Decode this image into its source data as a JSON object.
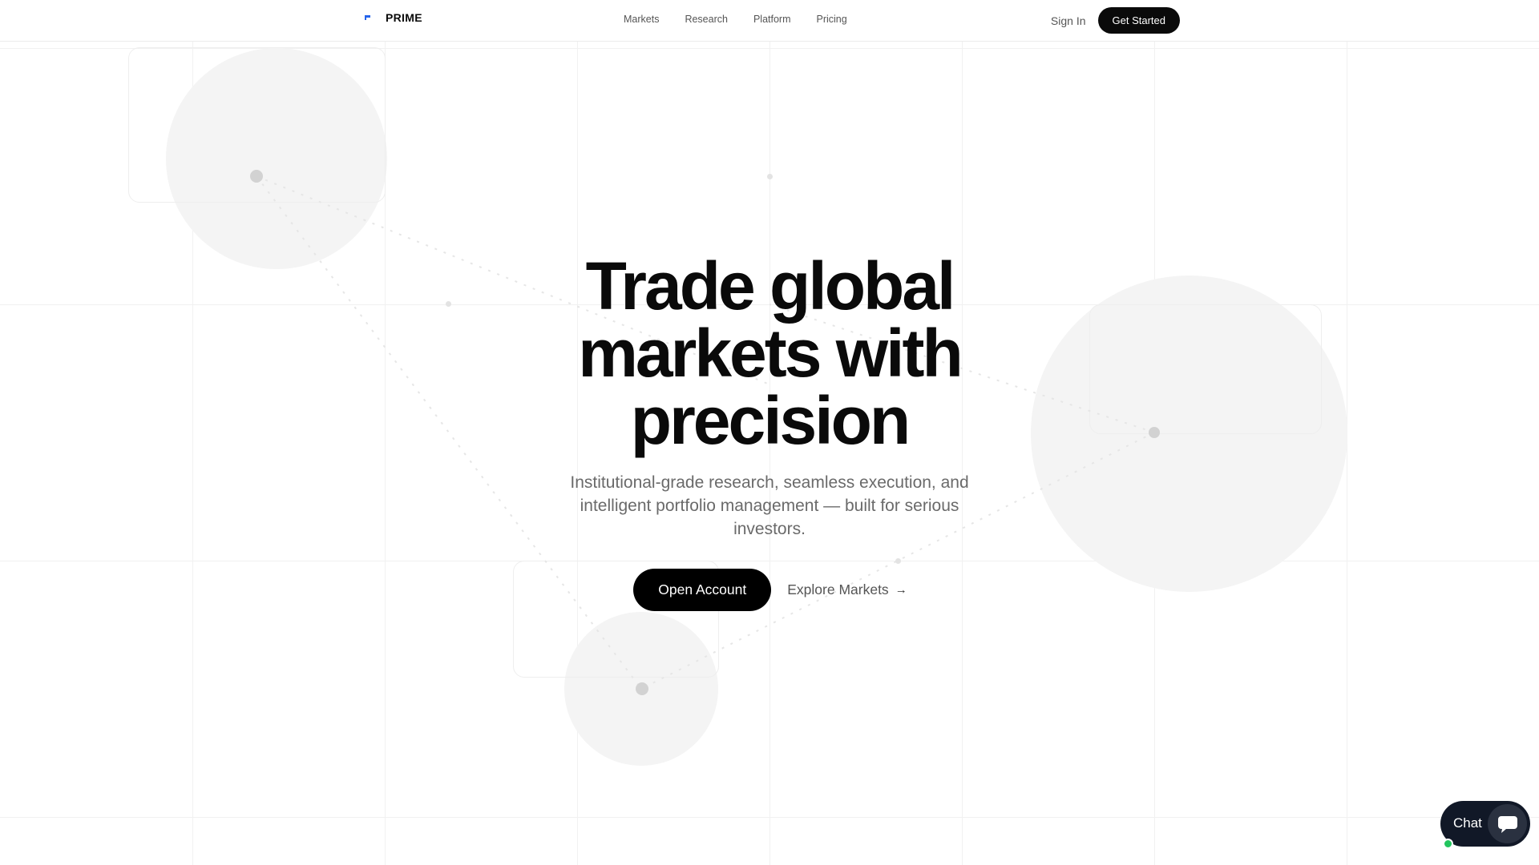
{
  "brand": {
    "name": "PRIME",
    "logo_icon": "prime-logo-icon",
    "accent": "#2563eb"
  },
  "nav": {
    "links": [
      "Markets",
      "Research",
      "Platform",
      "Pricing"
    ],
    "sign_in": "Sign In",
    "get_started": "Get Started"
  },
  "hero": {
    "title_lines": [
      "Trade global",
      "markets with",
      "precision"
    ],
    "subtitle_lines": [
      "Institutional-grade research, seamless execution, and",
      "intelligent portfolio management — built for serious",
      "investors."
    ],
    "primary_cta": "Open Account",
    "secondary_cta": "Explore Markets",
    "secondary_icon": "arrow-right-icon"
  },
  "chat": {
    "label": "Chat",
    "icon": "chat-bubble-icon",
    "status_color": "#22c55e"
  },
  "colors": {
    "text": "#0a0a0a",
    "muted": "#6a6a6a",
    "button_dark": "#000000",
    "chat_bg": "#111827"
  }
}
